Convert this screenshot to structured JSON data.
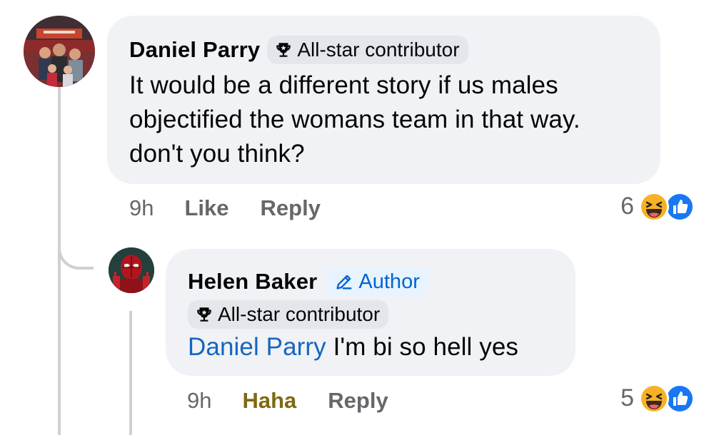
{
  "comments": [
    {
      "author": "Daniel Parry",
      "badge": "All-star contributor",
      "text": "It would be a different story if us males objectified the womans team in that way. don't you think?",
      "time": "9h",
      "like_label": "Like",
      "reply_label": "Reply",
      "reaction_count": "6",
      "reactions": [
        "haha-reaction-icon",
        "like-reaction-icon"
      ]
    }
  ],
  "reply": {
    "author": "Helen Baker",
    "author_badge": "Author",
    "badge": "All-star contributor",
    "mention": "Daniel Parry",
    "text": " I'm bi so hell yes",
    "time": "9h",
    "reaction_label": "Haha",
    "reply_label": "Reply",
    "reaction_count": "5",
    "reactions": [
      "haha-reaction-icon",
      "like-reaction-icon"
    ]
  },
  "colors": {
    "bubble": "#f0f2f5",
    "badge": "#e4e6eb",
    "author_badge_bg": "#e7f3ff",
    "author_badge_text": "#0064d1",
    "mention": "#1565c0",
    "meta": "#65676b",
    "haha_active": "#7d6a12",
    "like_blue": "#1877f2",
    "haha_yellow": "#f7b125"
  }
}
